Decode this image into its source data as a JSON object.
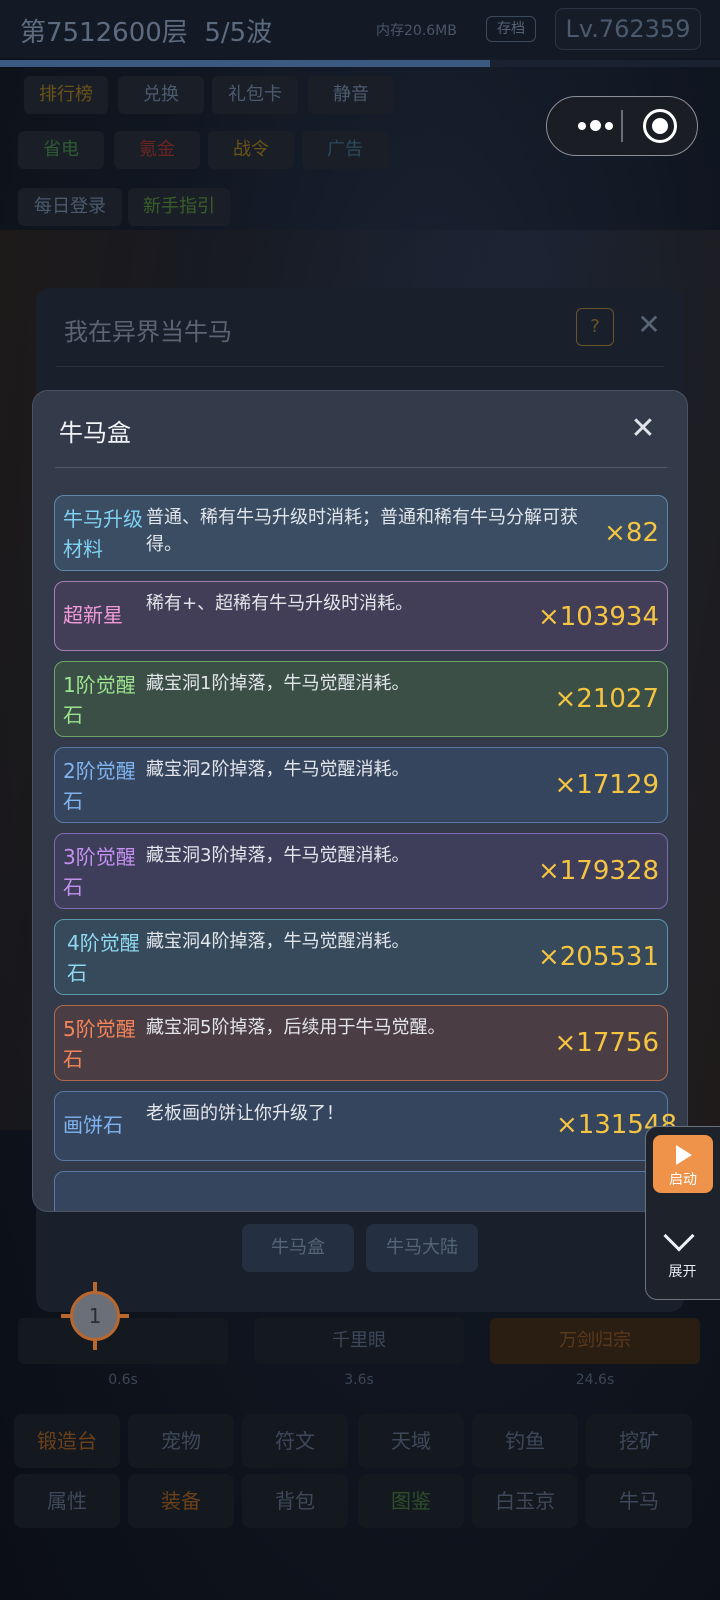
{
  "status": {
    "floor": "第7512600层",
    "wave": "5/5波",
    "memory": "内存20.6MB",
    "save_label": "存档",
    "level": "Lv.762359",
    "wave_progress": 0.68
  },
  "top_chips": [
    "排行榜",
    "兑换",
    "礼包卡",
    "静音",
    "省电",
    "氪金",
    "战令",
    "广告",
    "每日登录",
    "新手指引"
  ],
  "back_dialog": {
    "title": "我在异界当牛马",
    "help_label": "?",
    "close_glyph": "✕",
    "tabs": [
      "牛马盒",
      "牛马大陆"
    ]
  },
  "skills": [
    {
      "name": "",
      "time": "0.6s"
    },
    {
      "name": "千里眼",
      "time": "3.6s"
    },
    {
      "name": "万剑归宗",
      "time": "24.6s"
    }
  ],
  "marker": {
    "number": "1"
  },
  "bottom_nav": [
    "锻造台",
    "宠物",
    "符文",
    "天域",
    "钓鱼",
    "挖矿",
    "属性",
    "装备",
    "背包",
    "图鉴",
    "白玉京",
    "牛马"
  ],
  "modal": {
    "title": "牛马盒",
    "close_glyph": "✕",
    "items": [
      {
        "name": "牛马升级材料",
        "desc": "普通、稀有牛马升级时消耗；普通和稀有牛马分解可获得。",
        "count": "×82"
      },
      {
        "name": "超新星",
        "desc": "稀有+、超稀有牛马升级时消耗。",
        "count": "×103934"
      },
      {
        "name": "1阶觉醒石",
        "desc": "藏宝洞1阶掉落，牛马觉醒消耗。",
        "count": "×21027"
      },
      {
        "name": "2阶觉醒石",
        "desc": "藏宝洞2阶掉落，牛马觉醒消耗。",
        "count": "×17129"
      },
      {
        "name": "3阶觉醒石",
        "desc": "藏宝洞3阶掉落，牛马觉醒消耗。",
        "count": "×179328"
      },
      {
        "name": "4阶觉醒石",
        "desc": "藏宝洞4阶掉落，牛马觉醒消耗。",
        "count": "×205531"
      },
      {
        "name": "5阶觉醒石",
        "desc": "藏宝洞5阶掉落，后续用于牛马觉醒。",
        "count": "×17756"
      },
      {
        "name": "画饼石",
        "desc": "老板画的饼让你升级了！",
        "count": "×131548"
      }
    ]
  },
  "float_panel": {
    "start_label": "启动",
    "expand_label": "展开"
  }
}
